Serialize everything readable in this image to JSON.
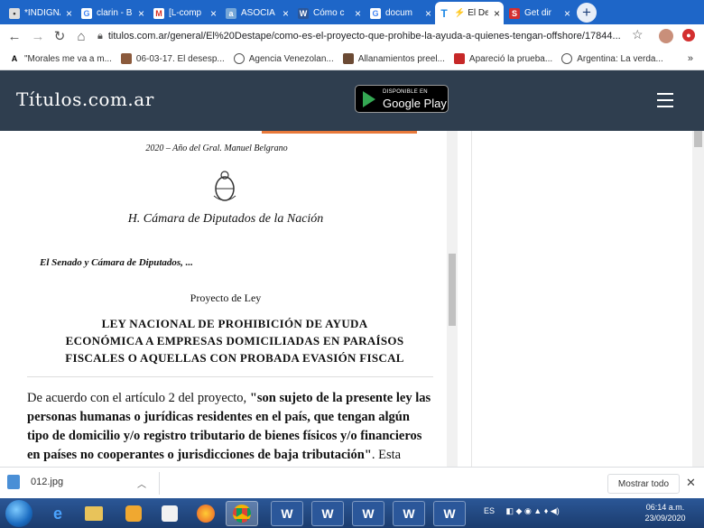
{
  "tabs": [
    {
      "label": "*INDIGNA",
      "favicon": "ipn-icon",
      "favicon_color": "#ddd",
      "active": false
    },
    {
      "label": "clarin - Bu",
      "favicon": "google-icon",
      "favicon_color": "#4285f4",
      "active": false
    },
    {
      "label": "[L-comp",
      "favicon": "gmail-icon",
      "favicon_color": "#d93025",
      "active": false
    },
    {
      "label": "ASOCIA",
      "favicon": "site-icon",
      "favicon_color": "#76a7d8",
      "active": false
    },
    {
      "label": "Cómo c",
      "favicon": "word-icon",
      "favicon_color": "#2b579a",
      "active": false
    },
    {
      "label": "docum",
      "favicon": "google-icon",
      "favicon_color": "#4285f4",
      "active": false
    },
    {
      "label": "⚡ El De",
      "favicon": "titulos-icon",
      "favicon_color": "#1e88e5",
      "active": true
    },
    {
      "label": "Get dir",
      "favicon": "s-icon",
      "favicon_color": "#d32f2f",
      "active": false
    }
  ],
  "nav": {
    "url": "titulos.com.ar/general/El%20Destape/como-es-el-proyecto-que-prohibe-la-ayuda-a-quienes-tengan-offshore/17844..."
  },
  "bookmarks": [
    {
      "label": "\"Morales me va a m...",
      "icon": "a-icon"
    },
    {
      "label": "06-03-17. El desesp...",
      "icon": "photo-icon"
    },
    {
      "label": "Agencia Venezolan...",
      "icon": "globe-icon"
    },
    {
      "label": "Allanamientos preel...",
      "icon": "photo-icon"
    },
    {
      "label": "Apareció la prueba...",
      "icon": "flag-icon"
    },
    {
      "label": "Argentina: La verda...",
      "icon": "globe-icon"
    }
  ],
  "site": {
    "logo": "Títulos.com.ar",
    "gplay_small": "DISPONIBLE EN",
    "gplay_big": "Google Play"
  },
  "doc": {
    "year_line": "2020 – Año del Gral. Manuel Belgrano",
    "camara": "H. Cámara de Diputados de la Nación",
    "senado": "El Senado y Cámara de Diputados, ...",
    "proyecto": "Proyecto de Ley",
    "ley_line1": "LEY NACIONAL DE PROHIBICIÓN DE AYUDA",
    "ley_line2": "ECONÓMICA A EMPRESAS DOMICILIADAS EN PARAÍSOS",
    "ley_line3": "FISCALES O AQUELLAS CON PROBADA EVASIÓN FISCAL"
  },
  "article": {
    "intro": "De acuerdo con el artículo 2 del proyecto, ",
    "quote": "\"son sujeto de la presente ley las personas humanas o jurídicas residentes en el país, que tengan algún tipo de domicilio y/o registro tributario de bienes físicos y/o financieros en países no cooperantes o jurisdicciones de baja tributación\"",
    "tail": ".  Esta"
  },
  "download": {
    "filename": "012.jpg",
    "show_all": "Mostrar todo"
  },
  "taskbar": {
    "lang": "ES",
    "time": "06:14 a.m.",
    "date": "23/09/2020"
  }
}
